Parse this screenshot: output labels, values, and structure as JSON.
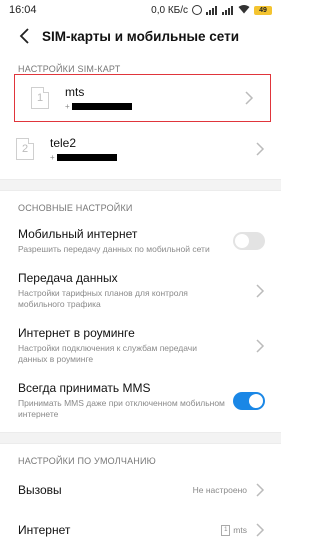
{
  "status": {
    "time": "16:04",
    "speed": "0,0 КБ/с",
    "battery": "49"
  },
  "header": {
    "title": "SIM-карты и мобильные сети"
  },
  "sim_section": {
    "label": "НАСТРОЙКИ SIM-КАРТ"
  },
  "sims": [
    {
      "slot": "1",
      "name": "mts",
      "number_prefix": "+"
    },
    {
      "slot": "2",
      "name": "tele2",
      "number_prefix": "+"
    }
  ],
  "basic_section": {
    "label": "ОСНОВНЫЕ НАСТРОЙКИ"
  },
  "settings": {
    "mobile_internet": {
      "title": "Мобильный интернет",
      "sub": "Разрешить передачу данных по мобильной сети",
      "enabled": false
    },
    "data_transfer": {
      "title": "Передача данных",
      "sub": "Настройки тарифных планов для контроля мобильного трафика"
    },
    "roaming": {
      "title": "Интернет в роуминге",
      "sub": "Настройки подключения к службам передачи данных в роуминге"
    },
    "mms": {
      "title": "Всегда принимать MMS",
      "sub": "Принимать MMS даже при отключенном мобильном интернете",
      "enabled": true
    }
  },
  "default_section": {
    "label": "НАСТРОЙКИ ПО УМОЛЧАНИЮ"
  },
  "defaults": {
    "calls": {
      "title": "Вызовы",
      "value": "Не настроено"
    },
    "internet": {
      "title": "Интернет",
      "value": "mts",
      "slot": "1"
    }
  },
  "colors": {
    "accent": "#1a87e6",
    "highlight": "#e0353b"
  }
}
